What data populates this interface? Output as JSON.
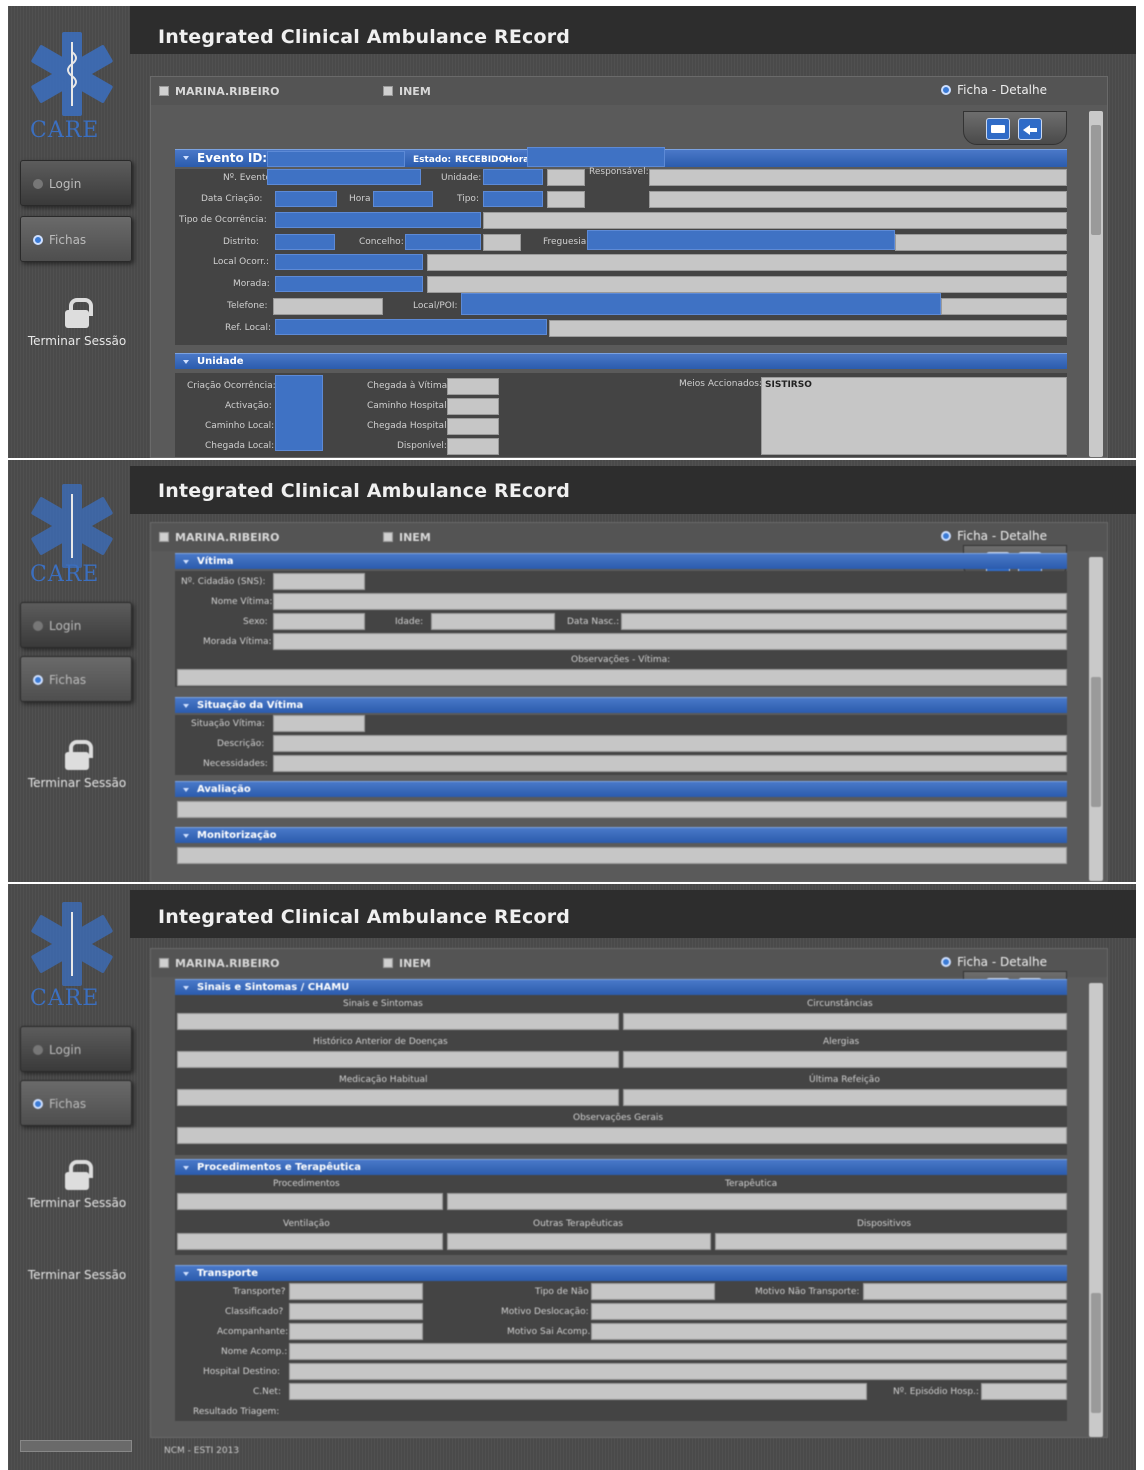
{
  "app": {
    "title": "Integrated Clinical Ambulance REcord",
    "logo_text": "CARE"
  },
  "sidebar": {
    "login": "Login",
    "fichas": "Fichas",
    "logout": "Terminar Sessão"
  },
  "header": {
    "user": "MARINA.RIBEIRO",
    "org": "INEM",
    "view": "Ficha - Detalhe"
  },
  "evento": {
    "title": "Evento ID:",
    "estado_label": "Estado:",
    "estado_value": "RECEBIDO",
    "hora_label": "Hora:",
    "labels": {
      "n_evento": "Nº. Evento",
      "unidade": "Unidade:",
      "responsavel": "Responsável:",
      "data_criacao": "Data Criação:",
      "hora": "Hora",
      "tipo": "Tipo:",
      "tipo_ocorrencia": "Tipo de Ocorrência:",
      "distrito": "Distrito:",
      "concelho": "Concelho:",
      "freguesia": "Freguesia",
      "local_ocorr": "Local Ocorr.:",
      "morada": "Morada:",
      "telefone": "Telefone:",
      "local_poi": "Local/POI:",
      "ref_local": "Ref. Local:"
    }
  },
  "unidade": {
    "title": "Unidade",
    "labels": {
      "criacao": "Criação Ocorrência:",
      "activacao": "Activação:",
      "caminho_local": "Caminho Local:",
      "chegada_local": "Chegada Local:",
      "chegada_vitima": "Chegada à Vítima:",
      "caminho_hospital": "Caminho Hospital:",
      "chegada_hospital": "Chegada Hospital:",
      "disponivel": "Disponível:",
      "meios": "Meios Accionados:"
    },
    "meios_value": "SISTIRSO"
  },
  "vitima": {
    "title": "Vítima",
    "labels": {
      "n_cidadao": "Nº. Cidadão (SNS):",
      "nome": "Nome Vítima:",
      "sexo": "Sexo:",
      "idade": "Idade:",
      "data_nasc": "Data Nasc.:",
      "morada": "Morada Vítima:",
      "observacoes": "Observações - Vítima:"
    }
  },
  "situacao": {
    "title": "Situação da Vítima",
    "labels": {
      "situacao": "Situação Vítima:",
      "descricao": "Descrição:",
      "necessidades": "Necessidades:"
    }
  },
  "avaliacao": {
    "title": "Avaliação"
  },
  "monitorizacao": {
    "title": "Monitorização"
  },
  "sinais": {
    "title": "Sinais e Sintomas / CHAMU",
    "labels": {
      "sinais": "Sinais e Sintomas",
      "circunstancias": "Circunstâncias",
      "historico": "Histórico Anterior de Doenças",
      "alergias": "Alergias",
      "medicacao": "Medicação Habitual",
      "ultima": "Última Refeição",
      "observacoes": "Observações Gerais"
    }
  },
  "procedimentos": {
    "title": "Procedimentos e Terapêutica",
    "labels": {
      "procedimentos": "Procedimentos",
      "terapeutica": "Terapêutica",
      "ventilacao": "Ventilação",
      "outras": "Outras Terapêuticas",
      "dispositivos": "Dispositivos"
    }
  },
  "transporte": {
    "title": "Transporte",
    "labels": {
      "transporte": "Transporte?",
      "classificado": "Classificado?",
      "acompanhante": "Acompanhante:",
      "nome": "Nome Acomp.:",
      "hospital": "Hospital Destino:",
      "cnet": "C.Net:",
      "resultado": "Resultado Triagem:",
      "tipo": "Tipo de Não",
      "motivo_nao": "Motivo Não Transporte:",
      "motivo_desl": "Motivo Deslocação:",
      "motivo_sai": "Motivo Sai Acomp.:",
      "n_episodio": "Nº. Episódio Hosp.:"
    }
  },
  "footer": "NCM - ESTI 2013",
  "sidebar_extra": "Terminar Sessão"
}
